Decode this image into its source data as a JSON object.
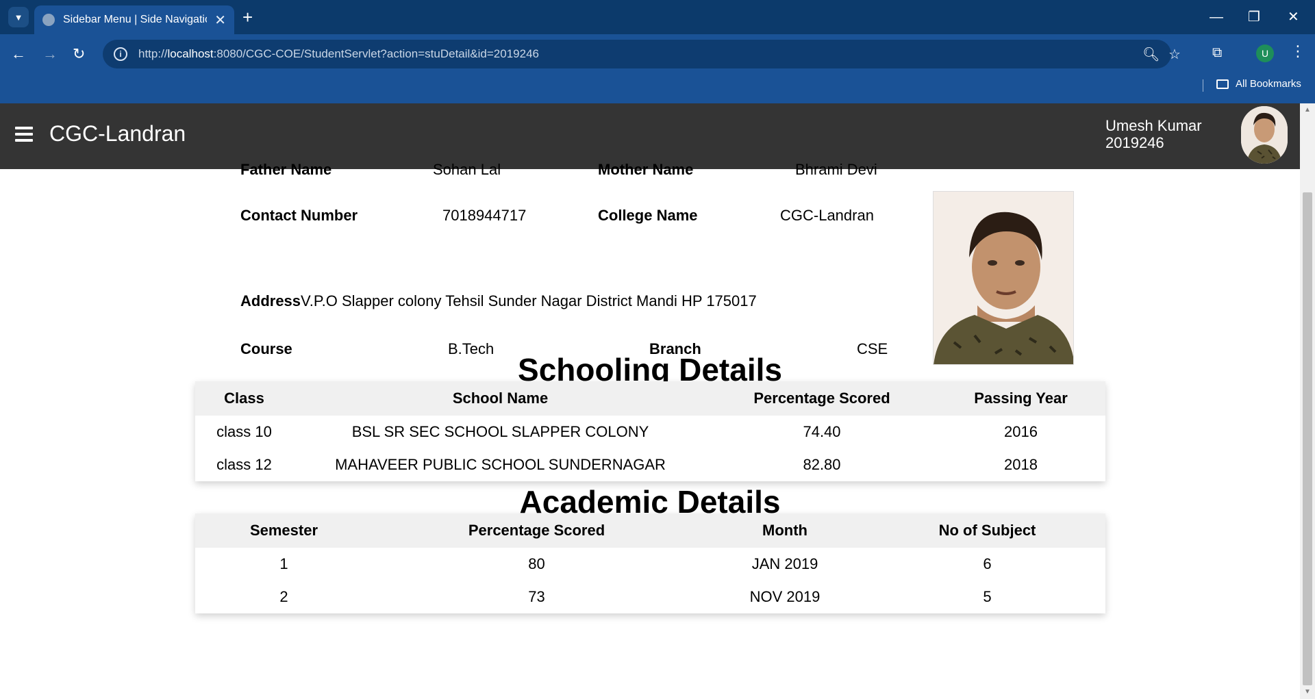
{
  "browser": {
    "tab_title": "Sidebar Menu | Side Navigation",
    "new_tab_symbol": "+",
    "url_prefix": "http://",
    "url_host": "localhost",
    "url_rest": ":8080/CGC-COE/StudentServlet?action=stuDetail&id=2019246",
    "profile_initial": "U",
    "bookmarks_label": "All Bookmarks"
  },
  "appbar": {
    "brand": "CGC-Landran",
    "user_name": "Umesh Kumar",
    "user_id": "2019246"
  },
  "student": {
    "father_label": "Father Name",
    "father_value": "Sohan Lal",
    "mother_label": "Mother Name",
    "mother_value": "Bhrami Devi",
    "contact_label": "Contact Number",
    "contact_value": "7018944717",
    "college_label": "College Name",
    "college_value": "CGC-Landran",
    "address_label": "Address",
    "address_value": "V.P.O Slapper colony Tehsil Sunder Nagar District Mandi HP 175017",
    "course_label": "Course",
    "course_value": "B.Tech",
    "branch_label": "Branch",
    "branch_value": "CSE"
  },
  "schooling": {
    "title": "Schooling Details",
    "headers": [
      "Class",
      "School Name",
      "Percentage Scored",
      "Passing Year"
    ],
    "rows": [
      [
        "class 10",
        "BSL SR SEC SCHOOL SLAPPER COLONY",
        "74.40",
        "2016"
      ],
      [
        "class 12",
        "MAHAVEER PUBLIC SCHOOL SUNDERNAGAR",
        "82.80",
        "2018"
      ]
    ]
  },
  "academic": {
    "title": "Academic Details",
    "headers": [
      "Semester",
      "Percentage Scored",
      "Month",
      "No of Subject"
    ],
    "rows": [
      [
        "1",
        "80",
        "JAN 2019",
        "6"
      ],
      [
        "2",
        "73",
        "NOV 2019",
        "5"
      ]
    ]
  },
  "colors": {
    "tab_strip": "#0c3a6b",
    "toolbar": "#1a5296",
    "appbar": "#343434",
    "table_header": "#f0f0f0"
  }
}
